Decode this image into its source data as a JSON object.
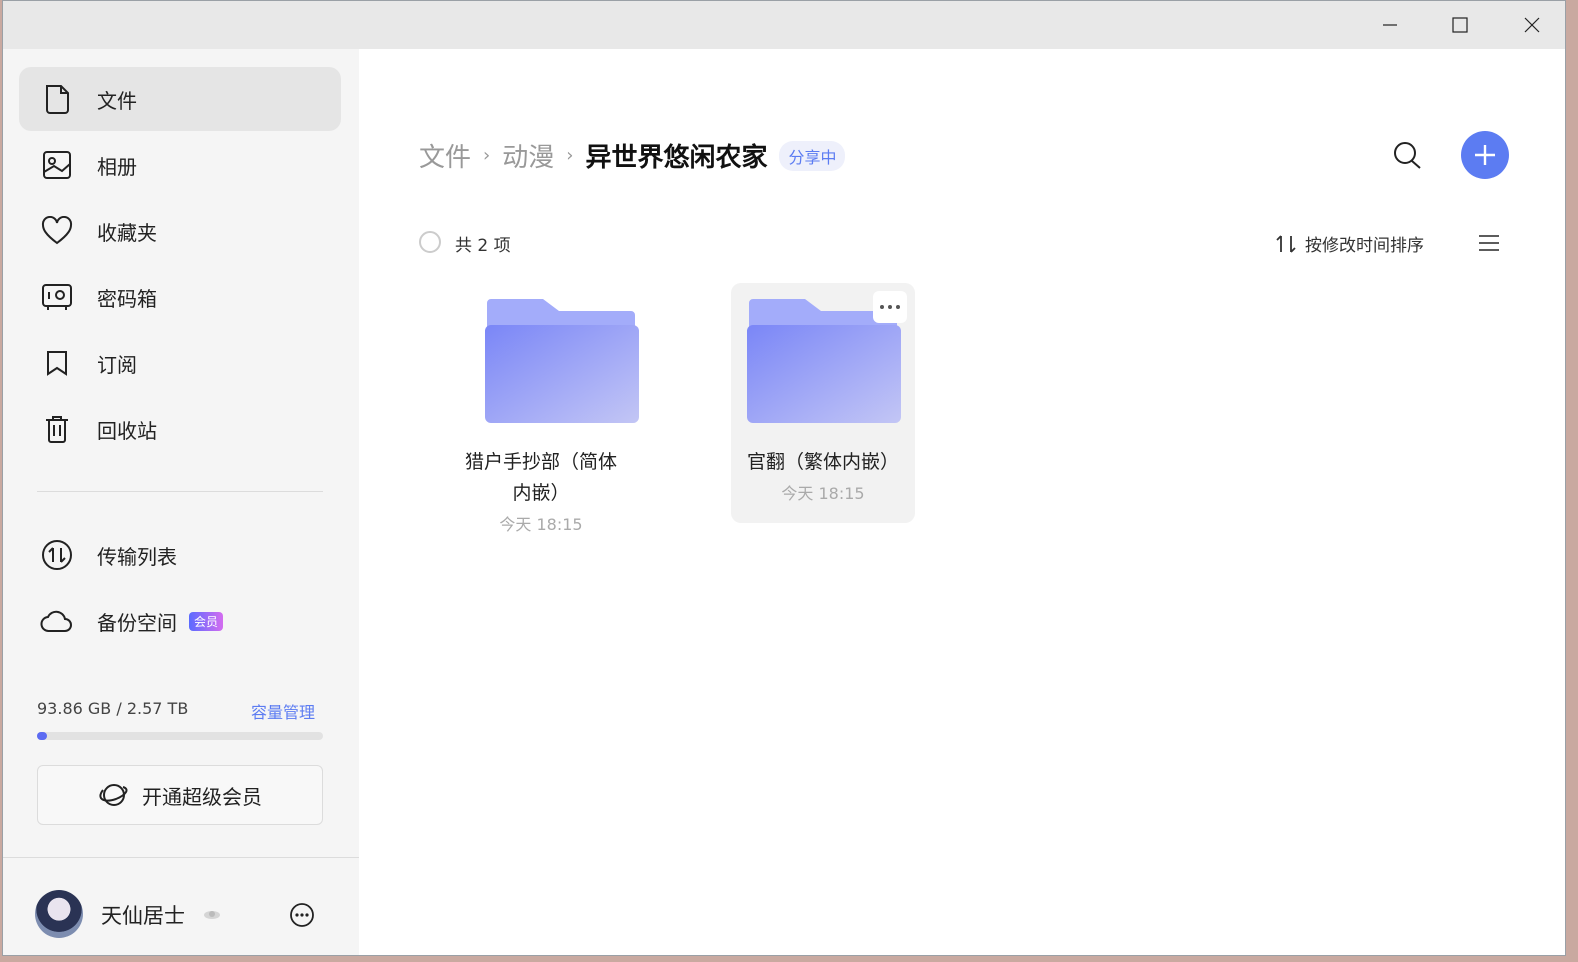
{
  "sidebar": {
    "items": [
      {
        "label": "文件",
        "icon": "file-icon"
      },
      {
        "label": "相册",
        "icon": "photo-album-icon"
      },
      {
        "label": "收藏夹",
        "icon": "heart-icon"
      },
      {
        "label": "密码箱",
        "icon": "safe-icon"
      },
      {
        "label": "订阅",
        "icon": "bookmark-icon"
      },
      {
        "label": "回收站",
        "icon": "trash-icon"
      }
    ],
    "tools": [
      {
        "label": "传输列表",
        "icon": "transfer-icon"
      },
      {
        "label": "备份空间",
        "icon": "cloud-icon",
        "badge": "会员"
      }
    ],
    "storage": {
      "used": "93.86 GB",
      "sep": "/",
      "total": "2.57 TB",
      "text": "93.86 GB / 2.57 TB",
      "manage": "容量管理",
      "fraction": 0.036
    },
    "vip_button": "开通超级会员",
    "user": {
      "name": "天仙居士"
    }
  },
  "breadcrumb": {
    "root": "文件",
    "parent": "动漫",
    "current": "异世界悠闲农家",
    "badge": "分享中"
  },
  "toolbar": {
    "count": "共 2 项",
    "sort": "按修改时间排序"
  },
  "files": [
    {
      "name": "猎户手抄部（简体内嵌）",
      "name_line1": "猎户手抄部（简体",
      "name_line2": "内嵌）",
      "time": "今天 18:15"
    },
    {
      "name": "官翻（繁体内嵌）",
      "time": "今天 18:15"
    }
  ],
  "colors": {
    "accent": "#5c7cf2",
    "folder_front": "#8b96f8",
    "folder_back": "#aab2fb",
    "sidebar_bg": "#f5f5f5"
  }
}
